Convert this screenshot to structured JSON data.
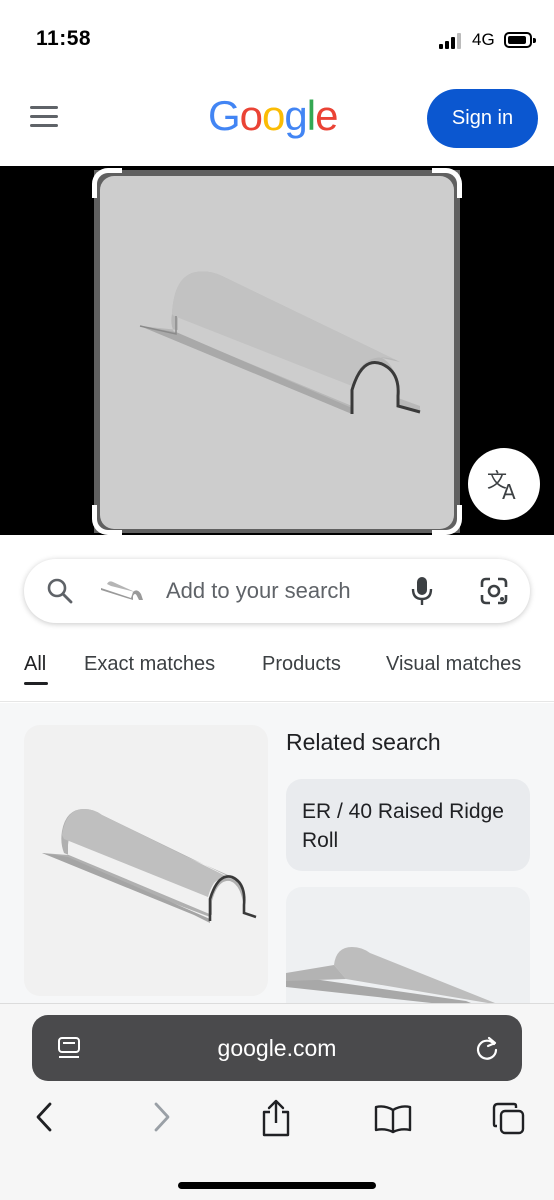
{
  "status_bar": {
    "time": "11:58",
    "network": "4G",
    "icons": [
      "signal-icon",
      "battery-icon"
    ]
  },
  "header": {
    "menu_icon": "hamburger-menu-icon",
    "logo_letters": [
      {
        "char": "G",
        "color": "#4285F4"
      },
      {
        "char": "o",
        "color": "#EA4335"
      },
      {
        "char": "o",
        "color": "#FBBC05"
      },
      {
        "char": "g",
        "color": "#4285F4"
      },
      {
        "char": "l",
        "color": "#34A853"
      },
      {
        "char": "e",
        "color": "#EA4335"
      }
    ],
    "signin_label": "Sign in",
    "signin_color": "#0b57d0"
  },
  "image_area": {
    "translate_icon": "translate-icon"
  },
  "search": {
    "placeholder": "Add to your search",
    "icons": [
      "search-icon",
      "mic-icon",
      "google-lens-icon"
    ]
  },
  "tabs": [
    {
      "label": "All",
      "active": true
    },
    {
      "label": "Exact matches",
      "active": false
    },
    {
      "label": "Products",
      "active": false
    },
    {
      "label": "Visual matches",
      "active": false
    }
  ],
  "results": {
    "related_title": "Related search",
    "related_chip": "ER / 40 Raised Ridge Roll"
  },
  "browser": {
    "url": "google.com",
    "icons": [
      "tabs-view-icon",
      "reload-icon",
      "back-icon",
      "forward-icon",
      "share-icon",
      "bookmarks-icon",
      "tabs-icon"
    ]
  }
}
